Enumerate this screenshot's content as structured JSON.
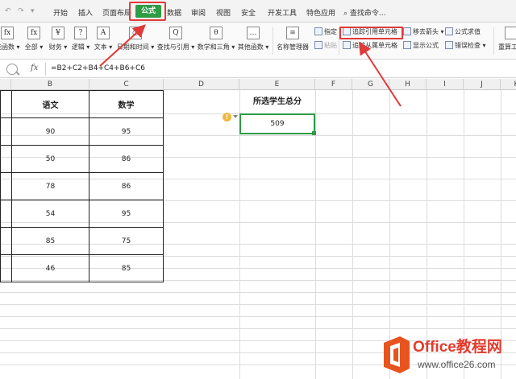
{
  "quick_access": [
    "↶",
    "↷",
    "▾"
  ],
  "tabs": [
    {
      "label": "开始",
      "active": false
    },
    {
      "label": "插入",
      "active": false
    },
    {
      "label": "页面布局",
      "active": false
    },
    {
      "label": "公式",
      "active": true
    },
    {
      "label": "数据",
      "active": false
    },
    {
      "label": "审阅",
      "active": false
    },
    {
      "label": "视图",
      "active": false
    },
    {
      "label": "安全",
      "active": false
    },
    {
      "label": "开发工具",
      "active": false
    },
    {
      "label": "特色应用",
      "active": false
    }
  ],
  "search_command": "查找命令...",
  "ribbon": {
    "buttons": [
      {
        "label": "能函数 ▾",
        "icon": "fx-icon",
        "glyph": "fx"
      },
      {
        "label": "全部 ▾",
        "icon": "fx-icon",
        "glyph": "fx"
      },
      {
        "label": "财务 ▾",
        "icon": "finance-icon",
        "glyph": "¥"
      },
      {
        "label": "逻辑 ▾",
        "icon": "logic-icon",
        "glyph": "?"
      },
      {
        "label": "文本 ▾",
        "icon": "text-icon",
        "glyph": "A"
      },
      {
        "label": "日期和时间 ▾",
        "icon": "date-icon",
        "glyph": "◷"
      },
      {
        "label": "查找与引用 ▾",
        "icon": "lookup-icon",
        "glyph": "Q"
      },
      {
        "label": "数学和三角 ▾",
        "icon": "math-icon",
        "glyph": "θ"
      },
      {
        "label": "其他函数 ▾",
        "icon": "more-functions-icon",
        "glyph": "…"
      },
      {
        "label": "名称管理器",
        "icon": "name-manager-icon",
        "glyph": "≡"
      }
    ],
    "small_buttons": [
      {
        "label": "指定",
        "disabled": false
      },
      {
        "label": "粘贴",
        "disabled": true
      },
      {
        "label": "追踪引用单元格",
        "disabled": false
      },
      {
        "label": "追踪从属单元格",
        "disabled": false
      },
      {
        "label": "移去箭头 ▾",
        "disabled": false
      },
      {
        "label": "显示公式",
        "disabled": false
      },
      {
        "label": "公式求值",
        "disabled": false
      },
      {
        "label": "错误检查 ▾",
        "disabled": false
      },
      {
        "label": "重算工作",
        "disabled": false
      }
    ]
  },
  "formula_bar": {
    "fx_label": "fx",
    "formula": "=B2+C2+B4+C4+B6+C6"
  },
  "columns": [
    "B",
    "C",
    "D",
    "E",
    "F",
    "G",
    "H",
    "I",
    "J",
    "K"
  ],
  "table": {
    "headers": [
      "语文",
      "数学"
    ],
    "rows": [
      [
        "90",
        "95"
      ],
      [
        "50",
        "86"
      ],
      [
        "78",
        "86"
      ],
      [
        "54",
        "95"
      ],
      [
        "85",
        "75"
      ],
      [
        "46",
        "85"
      ]
    ]
  },
  "result": {
    "title": "所选学生总分",
    "value": "509",
    "warning_glyph": "!"
  },
  "watermark": {
    "line1": "Office教程网",
    "line2": "www.office26.com"
  },
  "colors": {
    "accent_green": "#2e9b45",
    "highlight_red": "#e03a3a",
    "watermark_orange": "#e8541e"
  }
}
